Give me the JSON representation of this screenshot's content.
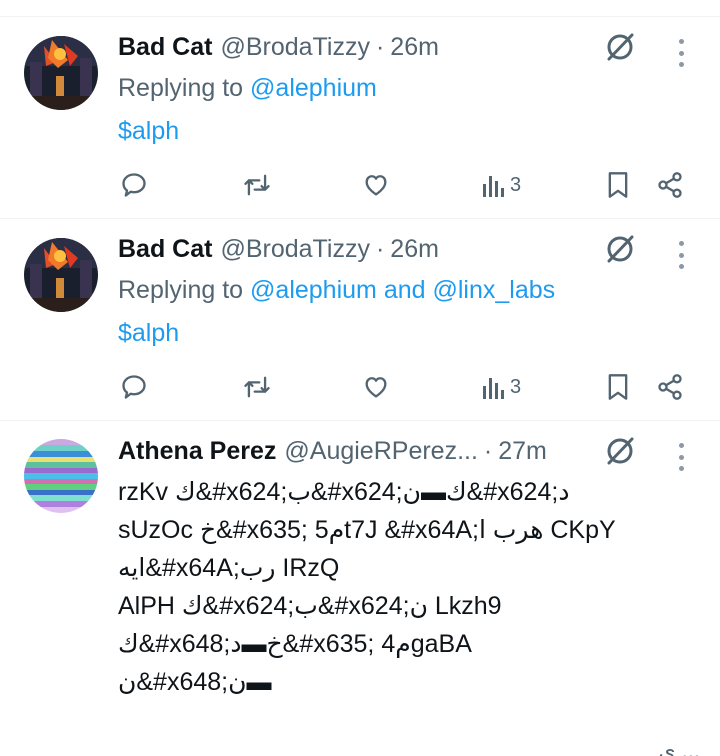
{
  "tweets": [
    {
      "name": "Bad Cat",
      "handle": "@BrodaTizzy",
      "separator": "·",
      "time": "26m",
      "reply_prefix": "Replying to",
      "mention_1": "@alephium",
      "reply_joiner": "",
      "mention_2": "",
      "body": "$alph",
      "views": "3"
    },
    {
      "name": "Bad Cat",
      "handle": "@BrodaTizzy",
      "separator": "·",
      "time": "26m",
      "reply_prefix": "Replying to",
      "mention_1": "@alephium",
      "reply_joiner": "and",
      "mention_2": "@linx_labs",
      "body": "$alph",
      "views": "3"
    },
    {
      "name": "Athena Perez",
      "handle": "@AugieRPerez...",
      "separator": "·",
      "time": "27m",
      "lines": [
        "rzKv ك&#x624;ب&#x624;ك▬ن&#x624;د",
        "sUzOc خ&#x635; م5t7J &#x64A;هرب ا CKpY",
        "ايه&#x64A;رب IRzQ",
        " AlPH ك&#x624;ب&#x624;ن Lkzh9",
        "ك&#x648;خ▬د&#x635; م4gaBA",
        "ن&#x648;ن▬"
      ]
    }
  ],
  "bottom_peek": "ي ...",
  "colors": {
    "accent": "#1d9bf0",
    "secondary": "#536471",
    "text": "#0f1419",
    "divider": "#eff3f4"
  },
  "icons": [
    "grok-icon",
    "more-icon",
    "reply-icon",
    "retweet-icon",
    "like-icon",
    "views-icon",
    "bookmark-icon",
    "share-icon"
  ]
}
